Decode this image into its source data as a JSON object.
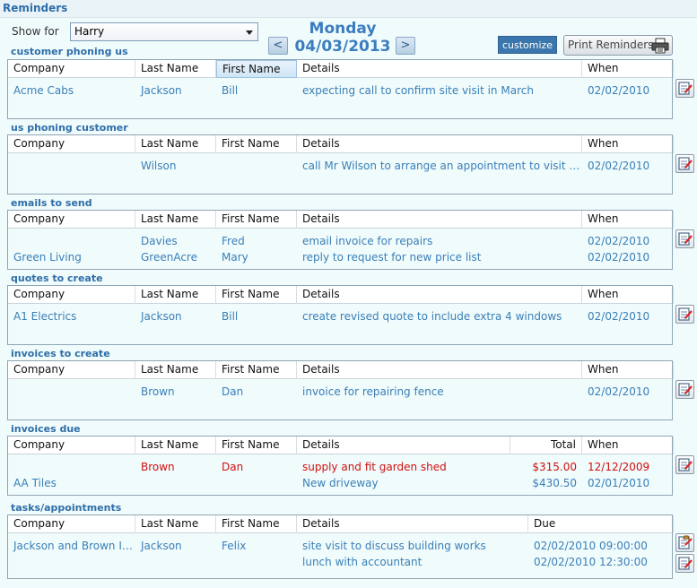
{
  "header": {
    "title": "Reminders"
  },
  "controls": {
    "show_for_label": "Show for",
    "show_for_value": "Harry",
    "day": "Monday",
    "date": "04/03/2013",
    "prev_glyph": "<",
    "next_glyph": ">",
    "customize_label": "customize",
    "print_label": "Print Reminders"
  },
  "icons": {
    "print": "printer-icon",
    "edit": "edit-note-icon",
    "task": "task-note-icon"
  },
  "colors": {
    "link": "#3a7fb7",
    "overdue": "#d01010",
    "title": "#2e6ea8"
  },
  "sections": [
    {
      "title": "customer phoning us",
      "headers": [
        "Company",
        "Last Name",
        "First Name",
        "Details",
        "When"
      ],
      "rows": [
        [
          "Acme Cabs",
          "Jackson",
          "Bill",
          "expecting call to confirm site visit in March",
          "02/02/2010"
        ]
      ]
    },
    {
      "title": "us phoning customer",
      "headers": [
        "Company",
        "Last Name",
        "First Name",
        "Details",
        "When"
      ],
      "rows": [
        [
          "",
          "Wilson",
          "",
          "call Mr Wilson to arrange an appointment to visit the property",
          "02/02/2010"
        ]
      ]
    },
    {
      "title": "emails to send",
      "headers": [
        "Company",
        "Last Name",
        "First Name",
        "Details",
        "When"
      ],
      "rows": [
        [
          "",
          "Davies",
          "Fred",
          "email invoice for repairs",
          "02/02/2010"
        ],
        [
          "Green Living",
          "GreenAcre",
          "Mary",
          "reply to request for new price list",
          "02/02/2010"
        ]
      ]
    },
    {
      "title": "quotes to create",
      "headers": [
        "Company",
        "Last Name",
        "First Name",
        "Details",
        "When"
      ],
      "rows": [
        [
          "A1 Electrics",
          "Jackson",
          "Bill",
          "create revised quote to include extra 4 windows",
          "02/02/2010"
        ]
      ]
    },
    {
      "title": "invoices to create",
      "headers": [
        "Company",
        "Last Name",
        "First Name",
        "Details",
        "When"
      ],
      "rows": [
        [
          "",
          "Brown",
          "Dan",
          "invoice for repairing fence",
          "02/02/2010"
        ]
      ]
    },
    {
      "title": "invoices due",
      "headers": [
        "Company",
        "Last Name",
        "First Name",
        "Details",
        "Total",
        "When"
      ],
      "rows": [
        [
          "",
          "Brown",
          "Dan",
          "supply and fit garden shed",
          "$315.00",
          "12/12/2009"
        ],
        [
          "AA Tiles",
          "",
          "",
          "New driveway",
          "$430.50",
          "02/01/2010"
        ]
      ]
    },
    {
      "title": "tasks/appointments",
      "headers": [
        "Company",
        "Last Name",
        "First Name",
        "Details",
        "Due"
      ],
      "rows": [
        [
          "Jackson and Brown Interiors",
          "Jackson",
          "Felix",
          "site visit to discuss building works",
          "02/02/2010 09:00:00"
        ],
        [
          "",
          "",
          "",
          "lunch with accountant",
          "02/02/2010 12:30:00"
        ]
      ]
    }
  ]
}
